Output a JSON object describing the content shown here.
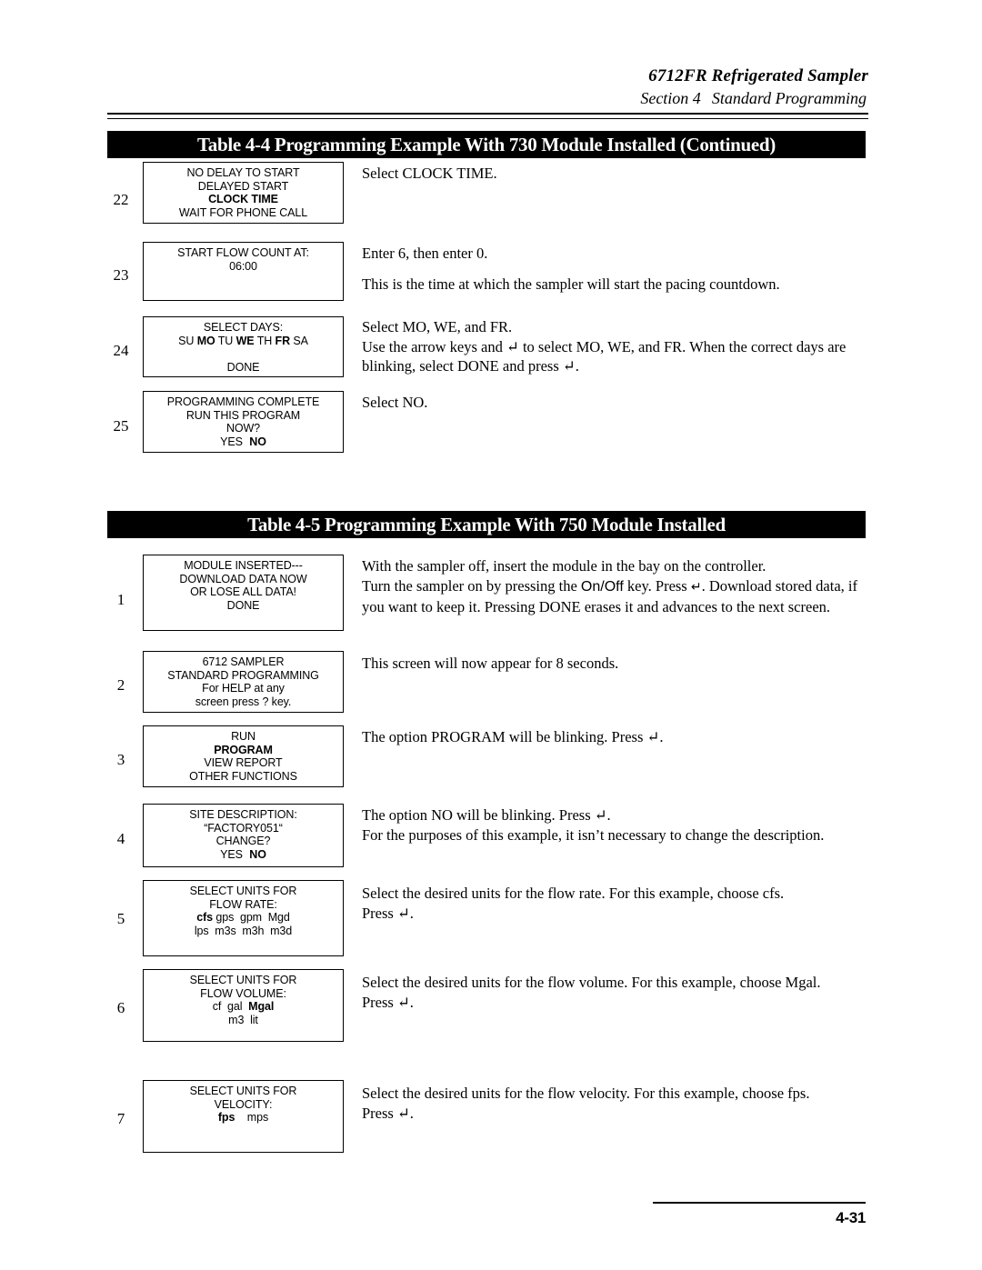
{
  "header": {
    "line1": "6712FR Refrigerated Sampler",
    "section_label": "Section 4",
    "section_title": "Standard Programming"
  },
  "tables": [
    {
      "caption": "Table 4-4  Programming Example With 730 Module Installed (Continued)",
      "rows": [
        {
          "num": "22",
          "screen_lines": [
            "NO DELAY TO START",
            "DELAYED START",
            "CLOCK TIME",
            "WAIT FOR PHONE CALL"
          ],
          "desc_paras": [
            "Select CLOCK TIME."
          ]
        },
        {
          "num": "23",
          "screen_lines": [
            "START FLOW COUNT AT:",
            "06:00"
          ],
          "desc_paras": [
            "Enter 6, then enter 0.",
            "This is the time at which the sampler will start the pacing countdown."
          ]
        },
        {
          "num": "24",
          "screen_lines": [
            "SELECT DAYS:",
            "SU MO TU WE TH FR SA",
            "",
            "DONE"
          ],
          "desc_paras": [
            "Select MO, WE, and FR.",
            "Use the arrow keys and  ↵ to select MO, WE, and FR. When the correct days are blinking, select DONE and press ↵."
          ]
        },
        {
          "num": "25",
          "screen_lines": [
            "PROGRAMMING COMPLETE",
            "RUN THIS PROGRAM",
            "NOW?",
            "YES  NO"
          ],
          "desc_paras": [
            "Select NO."
          ]
        }
      ]
    },
    {
      "caption": "Table 4-5  Programming Example With 750 Module Installed",
      "rows": [
        {
          "num": "1",
          "screen_lines": [
            "MODULE INSERTED---",
            "DOWNLOAD DATA NOW",
            "OR LOSE ALL DATA!",
            "DONE"
          ],
          "desc_paras": [
            "With the sampler off, insert the module in the bay on the controller.",
            "Turn the sampler on by pressing the On/Off key. Press ↵. Download stored data, if you want to keep it. Pressing DONE erases it and advances to the next screen."
          ]
        },
        {
          "num": "2",
          "screen_lines": [
            "6712 SAMPLER",
            "STANDARD PROGRAMMING",
            "For HELP at any",
            "screen press ? key."
          ],
          "desc_paras": [
            "This screen will now appear for 8 seconds."
          ]
        },
        {
          "num": "3",
          "screen_lines": [
            "RUN",
            "PROGRAM",
            "VIEW REPORT",
            "OTHER FUNCTIONS"
          ],
          "desc_paras": [
            "The option PROGRAM will be blinking. Press ↵."
          ]
        },
        {
          "num": "4",
          "screen_lines": [
            "SITE DESCRIPTION:",
            "“FACTORY051“",
            "CHANGE?",
            "YES  NO"
          ],
          "desc_paras": [
            "The option NO will be blinking. Press ↵.",
            "For the purposes of this example, it isn’t necessary to change the description."
          ]
        },
        {
          "num": "5",
          "screen_lines": [
            "SELECT UNITS FOR",
            "FLOW RATE:",
            "cfs gps gpm Mgd",
            "lps m3s m3h m3d"
          ],
          "desc_paras": [
            "Select the desired units for the flow rate. For this example, choose cfs.",
            "Press ↵."
          ]
        },
        {
          "num": "6",
          "screen_lines": [
            "SELECT UNITS FOR",
            "FLOW VOLUME:",
            "cf  gal  Mgal",
            "m3  lit"
          ],
          "desc_paras": [
            "Select the desired units for the flow volume. For this example, choose Mgal.",
            "Press ↵."
          ]
        },
        {
          "num": "7",
          "screen_lines": [
            "SELECT UNITS FOR",
            "VELOCITY:",
            "fps    mps"
          ],
          "desc_paras": [
            "Select the desired units for the flow velocity. For this example, choose fps.",
            "Press ↵."
          ]
        }
      ]
    }
  ],
  "footer": {
    "page_number": "4-31"
  }
}
